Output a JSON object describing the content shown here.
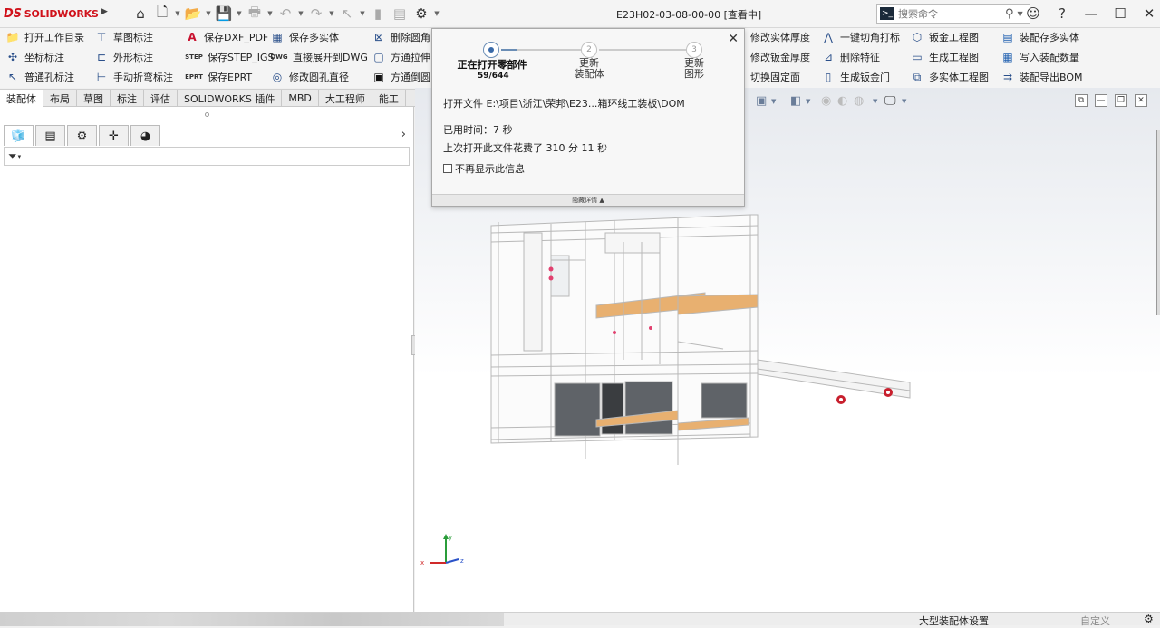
{
  "app": {
    "logo_text": "SOLIDWORKS",
    "logo_mark": "DS",
    "document_title": "E23H02-03-08-00-00 [查看中]"
  },
  "quick_access": {
    "icons": [
      "home-icon",
      "new-file-icon",
      "open-icon",
      "save-icon",
      "print-icon",
      "undo-icon",
      "redo-icon",
      "select-icon",
      "rebuild-icon",
      "file-props-icon",
      "options-icon"
    ]
  },
  "search": {
    "placeholder": "搜索命令"
  },
  "commands": {
    "c1": [
      "打开工作目录",
      "坐标标注",
      "普通孔标注"
    ],
    "c2": [
      "草图标注",
      "外形标注",
      "手动折弯标注"
    ],
    "c3": [
      "保存DXF_PDF",
      "保存STEP_IGS",
      "保存EPRT"
    ],
    "c3_prefix": [
      "",
      "STEP",
      "EPRT"
    ],
    "c4": [
      "保存多实体",
      "直接展开到DWG",
      "修改圆孔直径"
    ],
    "c4_prefix": [
      "",
      "DWG",
      ""
    ],
    "c5": [
      "删除圆角",
      "方通拉伸",
      "方通倒圆"
    ],
    "c6": [
      "修改实体厚度",
      "修改钣金厚度",
      "切换固定面"
    ],
    "c7": [
      "一键切角打标",
      "删除特征",
      "生成钣金门"
    ],
    "c8": [
      "钣金工程图",
      "生成工程图",
      "多实体工程图"
    ],
    "c9": [
      "装配存多实体",
      "写入装配数量",
      "装配导出BOM"
    ]
  },
  "tabs": [
    "装配体",
    "布局",
    "草图",
    "标注",
    "评估",
    "SOLIDWORKS 插件",
    "MBD",
    "大工程师",
    "能工"
  ],
  "progress_dialog": {
    "steps": [
      {
        "label": "正在打开零部件",
        "sub": "59/644",
        "number": "1"
      },
      {
        "label": "更新\n装配体",
        "number": "2"
      },
      {
        "label": "更新\n图形",
        "number": "3"
      }
    ],
    "opening_file": "打开文件 E:\\项目\\浙江\\荣邦\\E23...箱环线工装板\\DOM",
    "elapsed": "已用时间：7 秒",
    "last_time": "上次打开此文件花费了 310 分 11 秒",
    "dont_show": "不再显示此信息",
    "footer": "隐藏详情 ▲"
  },
  "status": {
    "mode": "大型装配体设置",
    "custom": "自定义"
  },
  "colors": {
    "brand": "#d0121b",
    "accent": "#3a6aa8",
    "wood": "#e8b070",
    "panel_dark": "#5f6368"
  }
}
